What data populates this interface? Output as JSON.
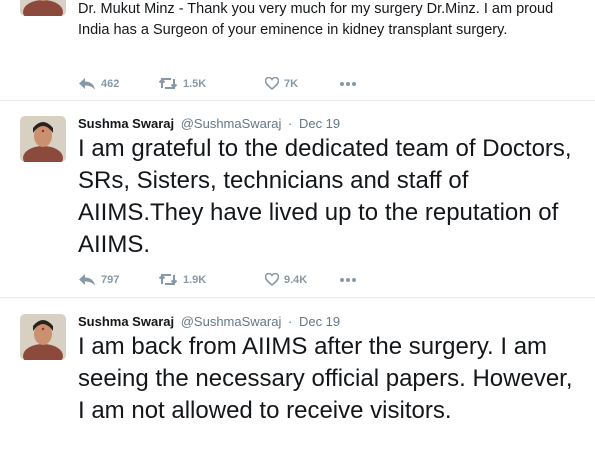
{
  "tweets": [
    {
      "name": "",
      "handle": "",
      "date": "",
      "text": "Dr. Mukut Minz - Thank you very much for my surgery Dr.Minz. I am proud India has a Surgeon of your eminence in kidney transplant surgery.",
      "replies": "462",
      "retweets": "1.5K",
      "likes": "7K"
    },
    {
      "name": "Sushma Swaraj",
      "handle": "@SushmaSwaraj",
      "sep": "·",
      "date": "Dec 19",
      "text": "I am grateful to the dedicated team of Doctors, SRs, Sisters, technicians and staff of AIIMS.They have lived up to the reputation of AIIMS.",
      "replies": "797",
      "retweets": "1.9K",
      "likes": "9.4K"
    },
    {
      "name": "Sushma Swaraj",
      "handle": "@SushmaSwaraj",
      "sep": "·",
      "date": "Dec 19",
      "text": "I am back from AIIMS after the surgery. I am seeing the necessary official papers. However, I am not allowed to receive visitors."
    }
  ],
  "icons": {
    "reply": "reply-icon",
    "retweet": "retweet-icon",
    "like": "heart-icon",
    "more": "more-icon"
  },
  "colors": {
    "action_gray": "#8899a6",
    "meta_gray": "#657786",
    "divider": "#e6ecf0"
  }
}
